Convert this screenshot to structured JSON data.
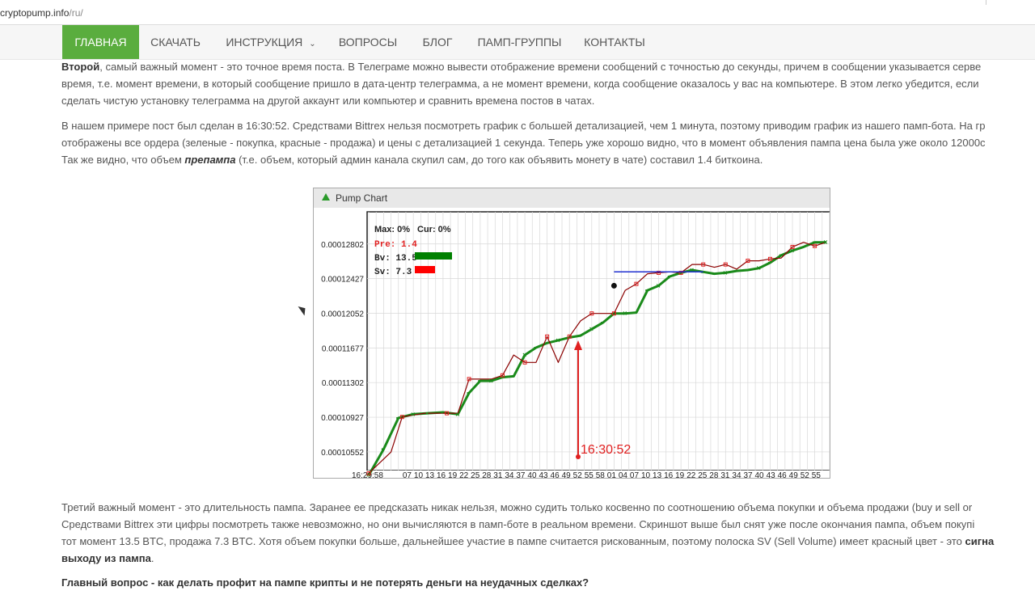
{
  "browser": {
    "url_host": "cryptopump.info",
    "url_path": "/ru/"
  },
  "nav": {
    "items": [
      {
        "label": "ГЛАВНАЯ"
      },
      {
        "label": "СКАЧАТЬ"
      },
      {
        "label": "ИНСТРУКЦИЯ"
      },
      {
        "label": "ВОПРОСЫ"
      },
      {
        "label": "БЛОГ"
      },
      {
        "label": "ПАМП-ГРУППЫ"
      },
      {
        "label": "КОНТАКТЫ"
      }
    ],
    "active_color": "#5aad3e"
  },
  "content": {
    "p1": {
      "lead": "Второй",
      "line1": ", самый важный момент - это точное время поста. В Телеграме можно вывести отображение времени сообщений с точностью до секунды, причем в сообщении указывается серве",
      "line2": "время, т.е. момент времени, в который сообщение пришло в дата-центр телеграмма, а не момент времени, когда сообщение оказалось у вас на компьютере. В этом легко убедится, если",
      "line3": "сделать чистую установку телеграмма на другой аккаунт или компьютер и сравнить времена постов в чатах."
    },
    "p2": {
      "line1": "В нашем примере пост был сделан в 16:30:52. Средствами Bittrex нельзя посмотреть график с большей детализацией, чем 1 минута, поэтому приводим график из нашего памп-бота. На гр",
      "line2": "отображены все ордера (зеленые - покупка, красные - продажа) и цены с детализацией 1 секунда. Теперь уже хорошо видно, что в момент объявления пампа цена была уже около 12000с",
      "line3_pre": "Так же видно, что объем ",
      "line3_em": "препампа",
      "line3_post": " (т.е. объем, который админ канала скупил сам, до того как объявить монету в чате) составил 1.4 биткоина."
    },
    "p3": {
      "line1": "Третий важный момент - это длительность пампа. Заранее ее предсказать никак нельзя, можно судить только косвенно по соотношению объема покупки и объема продажи (buy и sell or",
      "line2": "Средствами Bittrex эти цифры посмотреть также невозможно, но они вычисляются в памп-боте в реальном времени. Скриншот выше был снят уже после окончания пампа, объем покупі",
      "line3_pre": "тот момент 13.5 BTC, продажа 7.3 BTC. Хотя объем покупки больше, дальнейшее участие в пампе считается рискованным, поэтому полоска SV (Sell Volume) имеет красный цвет - это ",
      "line3_bold": "сигна",
      "line4": "выходу из пампа",
      "line4_end": "."
    },
    "p4_cut": "Главный вопрос - как делать профит на пампе крипты и не потерять деньги на неудачных сделках?"
  },
  "pump_chart": {
    "window_title": "Pump Chart",
    "stats": {
      "max": "Max: 0%",
      "cur": "Cur: 0%",
      "pre": "Pre: 1.4",
      "bv": "Bv: 13.5",
      "sv": "Sv: 7.3"
    },
    "annotation": "16:30:52",
    "colors": {
      "buy": "#1a8a1a",
      "sell": "#e02020",
      "price": "#8b0000",
      "bv_bar": "#008000",
      "sv_bar": "#ff0000",
      "marker": "#e02020"
    }
  },
  "chart_data": {
    "type": "line",
    "title": "",
    "y_ticks": [
      "0.00012802",
      "0.00012427",
      "0.00012052",
      "0.00011677",
      "0.00011302",
      "0.00010927",
      "0.00010552"
    ],
    "x_ticks": [
      "16:29:58",
      "07",
      "10",
      "13",
      "16",
      "19",
      "22",
      "25",
      "28",
      "31",
      "34",
      "37",
      "40",
      "43",
      "46",
      "49",
      "52",
      "55",
      "58",
      "01",
      "04",
      "07",
      "10",
      "13",
      "16",
      "19",
      "22",
      "25",
      "28",
      "31",
      "34",
      "37",
      "40",
      "43",
      "46",
      "49",
      "52",
      "55"
    ],
    "ylim": [
      0.0001035,
      0.0001315
    ],
    "series": [
      {
        "values": [
          [
            0,
            0.000103
          ],
          [
            4,
            0.0001058
          ],
          [
            8,
            0.0001092
          ],
          [
            12,
            0.0001096
          ],
          [
            16,
            0.0001097
          ],
          [
            20,
            0.0001098
          ],
          [
            24,
            0.0001096
          ],
          [
            27,
            0.0001119
          ],
          [
            30,
            0.0001132
          ],
          [
            33,
            0.0001132
          ],
          [
            36,
            0.0001136
          ],
          [
            39,
            0.0001137
          ],
          [
            42,
            0.000116
          ],
          [
            45,
            0.0001168
          ],
          [
            48,
            0.0001173
          ],
          [
            51,
            0.0001176
          ],
          [
            54,
            0.0001179
          ],
          [
            57,
            0.0001181
          ],
          [
            60,
            0.0001188
          ],
          [
            63,
            0.0001195
          ],
          [
            66,
            0.0001205
          ],
          [
            69,
            0.0001205
          ],
          [
            72,
            0.0001206
          ],
          [
            75,
            0.000123
          ],
          [
            78,
            0.0001235
          ],
          [
            81,
            0.0001245
          ],
          [
            84,
            0.0001249
          ],
          [
            87,
            0.0001252
          ],
          [
            90,
            0.000125
          ],
          [
            93,
            0.0001248
          ],
          [
            96,
            0.0001249
          ],
          [
            99,
            0.0001251
          ],
          [
            102,
            0.0001252
          ],
          [
            105,
            0.0001254
          ],
          [
            108,
            0.000126
          ],
          [
            111,
            0.0001268
          ],
          [
            114,
            0.0001273
          ],
          [
            117,
            0.0001277
          ],
          [
            120,
            0.0001282
          ],
          [
            123,
            0.0001282
          ]
        ]
      },
      {
        "values": [
          [
            0,
            0.0001032
          ],
          [
            6,
            0.0001055
          ],
          [
            9,
            0.0001093
          ],
          [
            15,
            0.0001097
          ],
          [
            21,
            0.0001097
          ],
          [
            24,
            0.0001097
          ],
          [
            27,
            0.0001134
          ],
          [
            33,
            0.0001134
          ],
          [
            36,
            0.0001138
          ],
          [
            39,
            0.000116
          ],
          [
            42,
            0.0001152
          ],
          [
            45,
            0.0001152
          ],
          [
            48,
            0.000118
          ],
          [
            51,
            0.0001152
          ],
          [
            54,
            0.000118
          ],
          [
            57,
            0.0001197
          ],
          [
            60,
            0.0001205
          ],
          [
            63,
            0.0001205
          ],
          [
            66,
            0.0001205
          ],
          [
            69,
            0.000123
          ],
          [
            72,
            0.0001237
          ],
          [
            75,
            0.0001248
          ],
          [
            78,
            0.0001249
          ],
          [
            81,
            0.000125
          ],
          [
            84,
            0.0001249
          ],
          [
            87,
            0.0001258
          ],
          [
            90,
            0.0001258
          ],
          [
            93,
            0.0001255
          ],
          [
            96,
            0.0001258
          ],
          [
            99,
            0.0001253
          ],
          [
            102,
            0.0001262
          ],
          [
            105,
            0.0001262
          ],
          [
            108,
            0.0001264
          ],
          [
            111,
            0.0001265
          ],
          [
            114,
            0.0001277
          ],
          [
            117,
            0.0001282
          ],
          [
            120,
            0.0001278
          ],
          [
            123,
            0.0001282
          ]
        ]
      }
    ],
    "annotations": [
      {
        "x": "16:30:52",
        "label": "16:30:52"
      }
    ],
    "grid": true
  }
}
